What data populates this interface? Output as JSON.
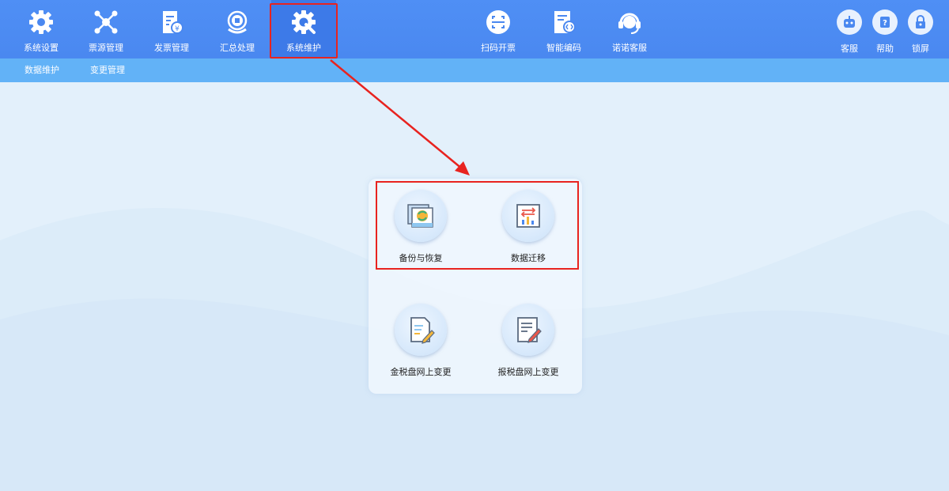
{
  "top_nav": {
    "items": [
      {
        "label": "系统设置",
        "icon": "gear-icon"
      },
      {
        "label": "票源管理",
        "icon": "network-icon"
      },
      {
        "label": "发票管理",
        "icon": "invoice-icon"
      },
      {
        "label": "汇总处理",
        "icon": "tax-summary-icon"
      },
      {
        "label": "系统维护",
        "icon": "maintenance-icon",
        "active": true
      }
    ],
    "center_items": [
      {
        "label": "扫码开票",
        "icon": "scan-icon"
      },
      {
        "label": "智能编码",
        "icon": "smart-code-icon"
      },
      {
        "label": "诺诺客服",
        "icon": "headset-icon"
      }
    ],
    "utility_items": [
      {
        "label": "客服",
        "icon": "robot-icon"
      },
      {
        "label": "帮助",
        "icon": "help-icon"
      },
      {
        "label": "锁屏",
        "icon": "lock-icon"
      }
    ]
  },
  "sub_nav": {
    "items": [
      {
        "label": "数据维护"
      },
      {
        "label": "变更管理"
      }
    ]
  },
  "tiles": [
    {
      "label": "备份与恢复",
      "icon": "backup-restore-icon"
    },
    {
      "label": "数据迁移",
      "icon": "data-migration-icon"
    },
    {
      "label": "金税盘网上变更",
      "icon": "document-edit-icon"
    },
    {
      "label": "报税盘网上变更",
      "icon": "form-edit-icon"
    }
  ],
  "colors": {
    "topbar": "#4a88f0",
    "subbar": "#62b2f7",
    "highlight": "#e8231f",
    "background": "#e3f0fb"
  }
}
